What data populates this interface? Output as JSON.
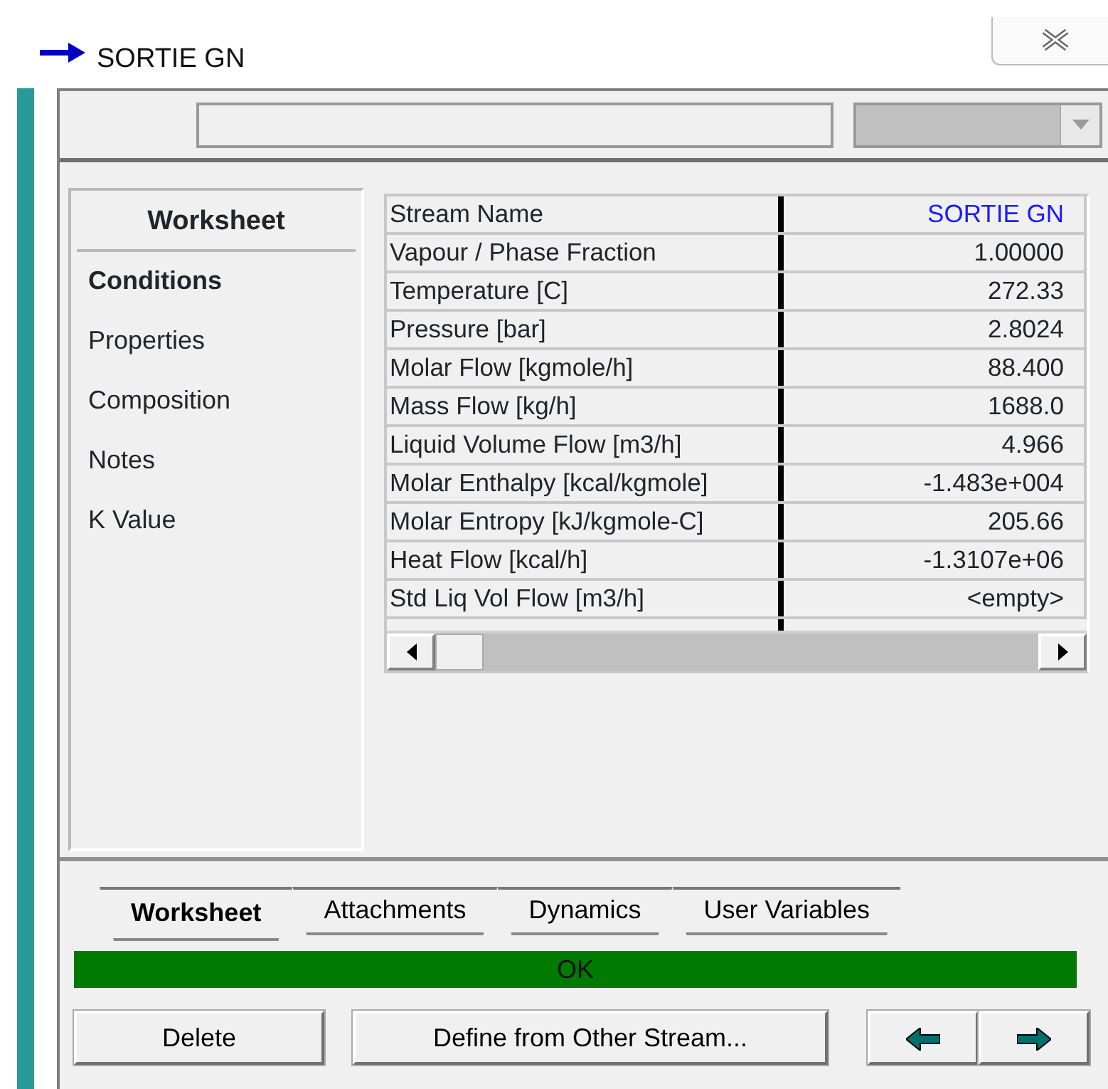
{
  "window": {
    "title": "SORTIE GN"
  },
  "sidebar": {
    "header": "Worksheet",
    "items": [
      {
        "label": "Conditions",
        "selected": true
      },
      {
        "label": "Properties",
        "selected": false
      },
      {
        "label": "Composition",
        "selected": false
      },
      {
        "label": "Notes",
        "selected": false
      },
      {
        "label": "K Value",
        "selected": false
      }
    ]
  },
  "table": {
    "rows": [
      {
        "label": "Stream Name",
        "value": "SORTIE GN",
        "kind": "name"
      },
      {
        "label": "Vapour / Phase Fraction",
        "value": "1.00000",
        "kind": "number"
      },
      {
        "label": "Temperature [C]",
        "value": "272.33",
        "kind": "number"
      },
      {
        "label": "Pressure [bar]",
        "value": "2.8024",
        "kind": "number"
      },
      {
        "label": "Molar Flow [kgmole/h]",
        "value": "88.400",
        "kind": "number"
      },
      {
        "label": "Mass Flow [kg/h]",
        "value": "1688.0",
        "kind": "number"
      },
      {
        "label": "Liquid Volume Flow [m3/h]",
        "value": "4.966",
        "kind": "number"
      },
      {
        "label": "Molar Enthalpy [kcal/kgmole]",
        "value": "-1.483e+004",
        "kind": "number"
      },
      {
        "label": "Molar Entropy [kJ/kgmole-C]",
        "value": "205.66",
        "kind": "number"
      },
      {
        "label": "Heat Flow [kcal/h]",
        "value": "-1.3107e+06",
        "kind": "number"
      },
      {
        "label": "Std Liq Vol Flow [m3/h]",
        "value": "<empty>",
        "kind": "number"
      }
    ]
  },
  "tabs": [
    {
      "label": "Worksheet",
      "selected": true
    },
    {
      "label": "Attachments",
      "selected": false
    },
    {
      "label": "Dynamics",
      "selected": false
    },
    {
      "label": "User Variables",
      "selected": false
    }
  ],
  "status": {
    "text": "OK"
  },
  "buttons": [
    "Delete",
    "Define from Other Stream..."
  ]
}
